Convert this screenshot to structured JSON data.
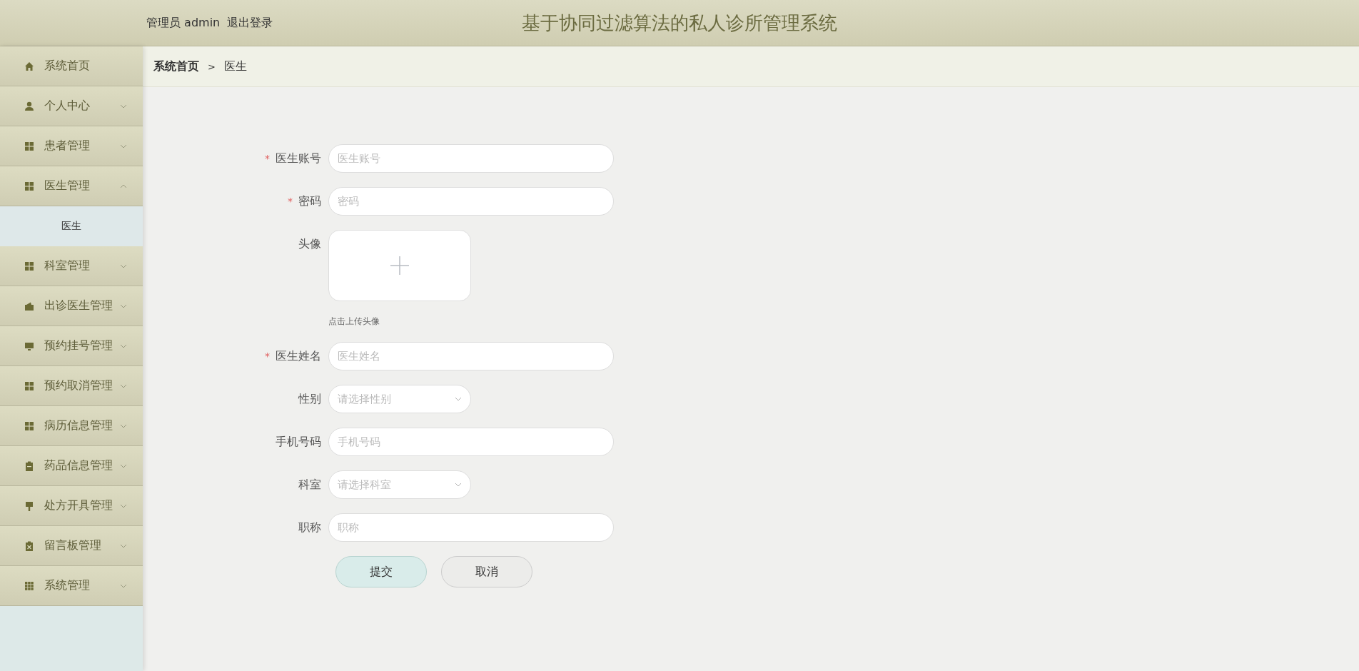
{
  "header": {
    "user_label": "管理员 admin",
    "logout": "退出登录",
    "title": "基于协同过滤算法的私人诊所管理系统"
  },
  "sidebar": {
    "items": [
      {
        "label": "系统首页",
        "kind": "link"
      },
      {
        "label": "个人中心",
        "kind": "menu",
        "expanded": false
      },
      {
        "label": "患者管理",
        "kind": "menu",
        "expanded": false
      },
      {
        "label": "医生管理",
        "kind": "menu",
        "expanded": true,
        "children": [
          {
            "label": "医生"
          }
        ]
      },
      {
        "label": "科室管理",
        "kind": "menu",
        "expanded": false
      },
      {
        "label": "出诊医生管理",
        "kind": "menu",
        "expanded": false
      },
      {
        "label": "预约挂号管理",
        "kind": "menu",
        "expanded": false
      },
      {
        "label": "预约取消管理",
        "kind": "menu",
        "expanded": false
      },
      {
        "label": "病历信息管理",
        "kind": "menu",
        "expanded": false
      },
      {
        "label": "药品信息管理",
        "kind": "menu",
        "expanded": false
      },
      {
        "label": "处方开具管理",
        "kind": "menu",
        "expanded": false
      },
      {
        "label": "留言板管理",
        "kind": "menu",
        "expanded": false
      },
      {
        "label": "系统管理",
        "kind": "menu",
        "expanded": false
      }
    ]
  },
  "breadcrumb": {
    "separator": ">",
    "items": [
      "系统首页",
      "医生"
    ]
  },
  "form": {
    "fields": [
      {
        "label": "医生账号",
        "kind": "text",
        "required_mark": "*",
        "placeholder": "医生账号"
      },
      {
        "label": "密码",
        "kind": "text",
        "required_mark": "*",
        "placeholder": "密码"
      },
      {
        "label": "头像",
        "kind": "upload",
        "hint": "点击上传头像"
      },
      {
        "label": "医生姓名",
        "kind": "text",
        "required_mark": "*",
        "placeholder": "医生姓名"
      },
      {
        "label": "性别",
        "kind": "select",
        "placeholder": "请选择性别"
      },
      {
        "label": "手机号码",
        "kind": "text",
        "placeholder": "手机号码"
      },
      {
        "label": "科室",
        "kind": "select",
        "placeholder": "请选择科室"
      },
      {
        "label": "职称",
        "kind": "text",
        "placeholder": "职称"
      }
    ],
    "buttons": [
      {
        "label": "提交",
        "kind": "primary"
      },
      {
        "label": "取消",
        "kind": "default"
      }
    ]
  }
}
